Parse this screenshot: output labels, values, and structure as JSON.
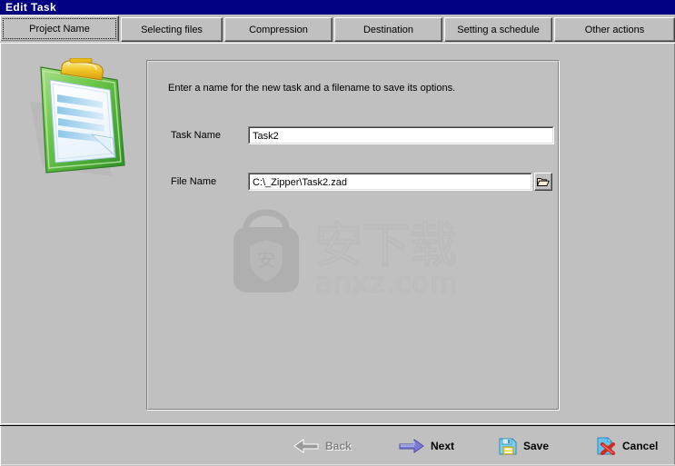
{
  "window": {
    "title": "Edit Task"
  },
  "colors": {
    "titlebar_bg": "#000080",
    "titlebar_text": "#ffffff",
    "face": "#c0c0c0",
    "field_bg": "#ffffff",
    "accent_next_arrow": "#7b7bd2",
    "disabled_text": "#808080",
    "cancel_x": "#d42a22",
    "clipboard_green": "#4fae3a",
    "clipboard_clip": "#e8b91f"
  },
  "tabs": [
    {
      "label": "Project Name",
      "active": true,
      "name": "tab-project-name"
    },
    {
      "label": "Selecting files",
      "active": false,
      "name": "tab-selecting-files"
    },
    {
      "label": "Compression",
      "active": false,
      "name": "tab-compression"
    },
    {
      "label": "Destination",
      "active": false,
      "name": "tab-destination"
    },
    {
      "label": "Setting a schedule",
      "active": false,
      "name": "tab-setting-a-schedule"
    },
    {
      "label": "Other actions",
      "active": false,
      "name": "tab-other-actions"
    }
  ],
  "sidebar": {
    "icon": "clipboard-icon"
  },
  "panel": {
    "intro": "Enter a name for the new task and a filename to save its options.",
    "fields": [
      {
        "label": "Task Name",
        "value": "Task2",
        "placeholder": "",
        "name": "task-name-input"
      },
      {
        "label": "File Name",
        "value": "C:\\_Zipper\\Task2.zad",
        "placeholder": "",
        "name": "file-name-input"
      }
    ],
    "browse": {
      "icon": "folder-open-icon",
      "tooltip": "Browse"
    }
  },
  "watermark": {
    "text_cn": "安下载",
    "text_domain": "anxz.com",
    "badge_char": "安"
  },
  "footer": {
    "buttons": [
      {
        "label": "Back",
        "icon": "arrow-left-icon",
        "enabled": false,
        "name": "back-button"
      },
      {
        "label": "Next",
        "icon": "arrow-right-icon",
        "enabled": true,
        "name": "next-button"
      },
      {
        "label": "Save",
        "icon": "floppy-disk-icon",
        "enabled": true,
        "name": "save-button"
      },
      {
        "label": "Cancel",
        "icon": "document-x-icon",
        "enabled": true,
        "name": "cancel-button"
      }
    ]
  }
}
